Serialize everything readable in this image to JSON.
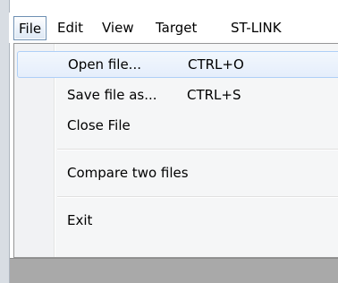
{
  "menubar": {
    "items": [
      {
        "label": "File",
        "active": true
      },
      {
        "label": "Edit"
      },
      {
        "label": "View"
      },
      {
        "label": "Target"
      },
      {
        "label": "ST-LINK"
      }
    ]
  },
  "file_menu": {
    "items": [
      {
        "label": "Open file...",
        "shortcut": "CTRL+O",
        "highlighted": true
      },
      {
        "label": "Save file as...",
        "shortcut": "CTRL+S"
      },
      {
        "label": "Close File"
      },
      {
        "label": "Compare two files"
      },
      {
        "label": "Exit"
      }
    ]
  }
}
